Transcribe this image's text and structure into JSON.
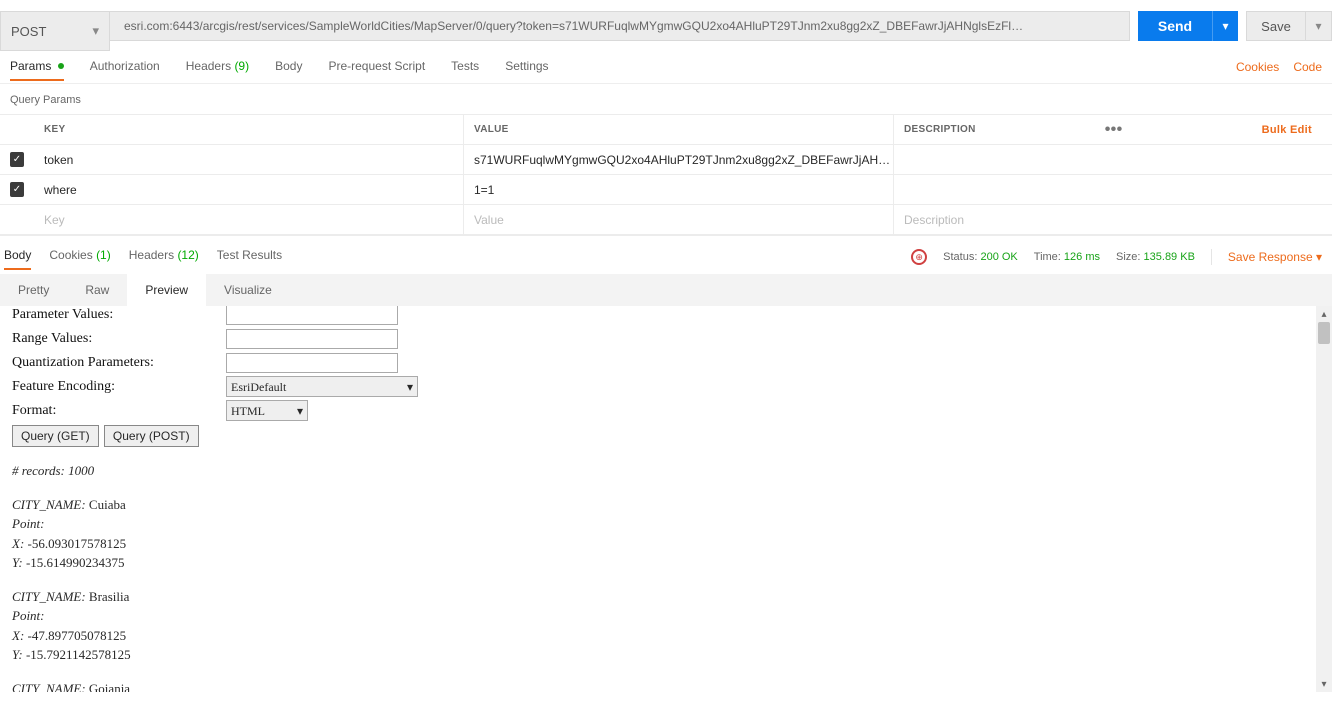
{
  "request": {
    "method": "POST",
    "url": "esri.com:6443/arcgis/rest/services/SampleWorldCities/MapServer/0/query?token=s71WURFuqlwMYgmwGQU2xo4AHluPT29TJnm2xu8gg2xZ_DBEFawrJjAHNglsEzFl…",
    "send": "Send",
    "save": "Save"
  },
  "reqTabs": {
    "params": "Params",
    "authorization": "Authorization",
    "headers": "Headers",
    "headers_count": "(9)",
    "body": "Body",
    "prerequest": "Pre-request Script",
    "tests": "Tests",
    "settings": "Settings",
    "cookies": "Cookies",
    "code": "Code"
  },
  "queryParams": {
    "title": "Query Params",
    "colKey": "KEY",
    "colValue": "VALUE",
    "colDesc": "DESCRIPTION",
    "bulkEdit": "Bulk Edit",
    "rows": [
      {
        "key": "token",
        "value": "s71WURFuqlwMYgmwGQU2xo4AHluPT29TJnm2xu8gg2xZ_DBEFawrJjAH…"
      },
      {
        "key": "where",
        "value": "1=1"
      }
    ],
    "ph_key": "Key",
    "ph_value": "Value",
    "ph_desc": "Description"
  },
  "respTabs": {
    "body": "Body",
    "cookies": "Cookies",
    "cookies_count": "(1)",
    "headers": "Headers",
    "headers_count": "(12)",
    "testResults": "Test Results"
  },
  "respMeta": {
    "statusLabel": "Status:",
    "statusValue": "200 OK",
    "timeLabel": "Time:",
    "timeValue": "126 ms",
    "sizeLabel": "Size:",
    "sizeValue": "135.89 KB",
    "saveResponse": "Save Response"
  },
  "viewTabs": {
    "pretty": "Pretty",
    "raw": "Raw",
    "preview": "Preview",
    "visualize": "Visualize"
  },
  "previewForm": {
    "parameterValues": "Parameter Values:",
    "rangeValues": "Range Values:",
    "quantization": "Quantization Parameters:",
    "featureEncoding": "Feature Encoding:",
    "featureEncodingValue": "EsriDefault",
    "format": "Format:",
    "formatValue": "HTML",
    "queryGet": "Query (GET)",
    "queryPost": "Query (POST)"
  },
  "results": {
    "recordsHeader": "# records: 1000",
    "records": [
      {
        "city": "Cuiaba",
        "geom": "Point:",
        "x": "-56.093017578125",
        "y": "-15.614990234375"
      },
      {
        "city": "Brasilia",
        "geom": "Point:",
        "x": "-47.897705078125",
        "y": "-15.7921142578125"
      },
      {
        "city": "Goiania",
        "geom": "",
        "x": "",
        "y": ""
      }
    ]
  }
}
